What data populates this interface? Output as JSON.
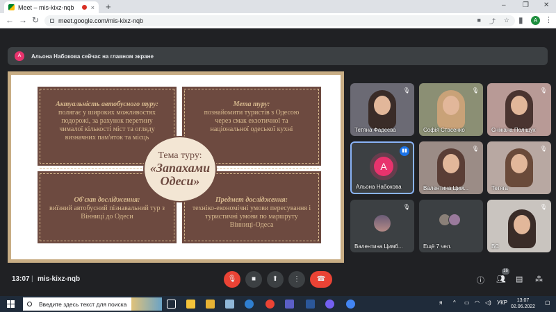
{
  "browser": {
    "tab_title": "Meet – mis-kixz-nqb",
    "tab_close": "×",
    "new_tab": "+",
    "url": "meet.google.com/mis-kixz-nqb",
    "profile_initial": "A",
    "window_controls": [
      "–",
      "❐",
      "✕"
    ]
  },
  "notification": {
    "avatar_initial": "A",
    "text": "Альона Набокова сейчас на главном экране"
  },
  "slide": {
    "center_title": "Тема туру:",
    "center_name_line1": "«Запахами",
    "center_name_line2": "Одеси»",
    "q1_heading": "Актуальність автобусного туру:",
    "q1_body": "полягає у широких можливостях подорожі, за рахунок перетину чималої кількості міст та огляду визначних пам'яток та місць",
    "q2_heading": "Мета туру:",
    "q2_body": "познайомити туристів з Одесою через смак екзотичної та національної одеської кухні",
    "q3_heading": "Об'єкт дослідження:",
    "q3_body": "виїзний автобусний пізнавальний тур з Вінниці до Одеси",
    "q4_heading": "Предмет дослідження:",
    "q4_body": "техніко-економічні умови пересування і туристичні умови по маршруту Вінниці-Одеса"
  },
  "participants": [
    {
      "name": "Тетяна Фадєєва"
    },
    {
      "name": "Софія Стасенко"
    },
    {
      "name": "Сніжана Поліщук"
    },
    {
      "name": "Альона Набокова",
      "initial": "A"
    },
    {
      "name": "Валентина Цим..."
    },
    {
      "name": "Тетяга"
    },
    {
      "name": "Валентина Цимб..."
    },
    {
      "name": "Ещё 7 чел."
    },
    {
      "name": "ВС"
    }
  ],
  "controls": {
    "time": "13:07",
    "divider": "|",
    "meeting_code": "mis-kixz-nqb",
    "participants_count": "16"
  },
  "taskbar": {
    "search_placeholder": "Введите здесь текст для поиска",
    "language": "УКР",
    "time": "13:07",
    "date": "02.06.2022"
  },
  "colors": {
    "slide_brown": "#6d4a40",
    "slide_text": "#d7b98e",
    "meet_bg": "#202124",
    "danger_red": "#ea4335",
    "accent_blue": "#1a73e8"
  }
}
